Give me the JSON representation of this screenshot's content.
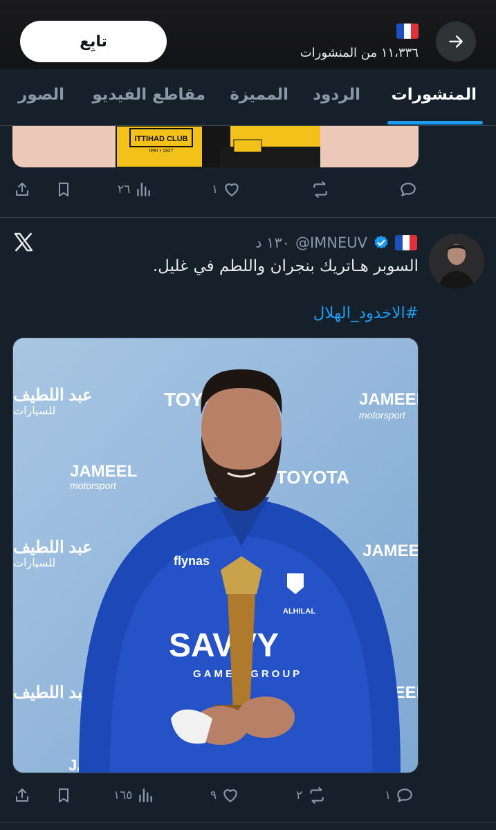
{
  "header": {
    "follow_label": "تابِع",
    "posts_count": "١١،٣٣٦ من المنشورات",
    "flag_icon": "france-flag-icon",
    "back_icon": "arrow-right-icon"
  },
  "tabs": [
    {
      "label": "المنشورات",
      "active": true
    },
    {
      "label": "الردود",
      "active": false
    },
    {
      "label": "المميزة",
      "active": false
    },
    {
      "label": "مقاطع الفيديو",
      "active": false
    },
    {
      "label": "الصور",
      "active": false
    }
  ],
  "post1": {
    "image_text_1": "ITTIHAD CLUB",
    "image_text_2": "IPEI • 1927",
    "actions": {
      "reply_count": "",
      "repost_count": "",
      "like_count": "١",
      "views_count": "٢٦"
    }
  },
  "post2": {
    "handle": "@IMNEUV",
    "time": "١٣٠ د",
    "text": "السوبر هـاتريك بنجران واللطم في غليل.",
    "hashtag": "#الاخدود_الهلال",
    "image_texts": {
      "sponsor_toyota": "TOYOTA",
      "sponsor_jameel": "JAMEEL",
      "sponsor_jameel_sub": "motorsport",
      "sponsor_abdullatif": "عبد اللطيف",
      "sponsor_abdullatif_sub": "للسيارات",
      "jersey_sponsor": "SAVVY",
      "jersey_sponsor_sub": "GAMES GROUP",
      "jersey_brand": "flynas",
      "club": "ALHILAL"
    },
    "actions": {
      "reply_count": "١",
      "repost_count": "٢",
      "like_count": "٩",
      "views_count": "١٦٥"
    }
  },
  "colors": {
    "background": "#15202b",
    "accent": "#1d9bf0",
    "muted": "#8b98a5"
  }
}
